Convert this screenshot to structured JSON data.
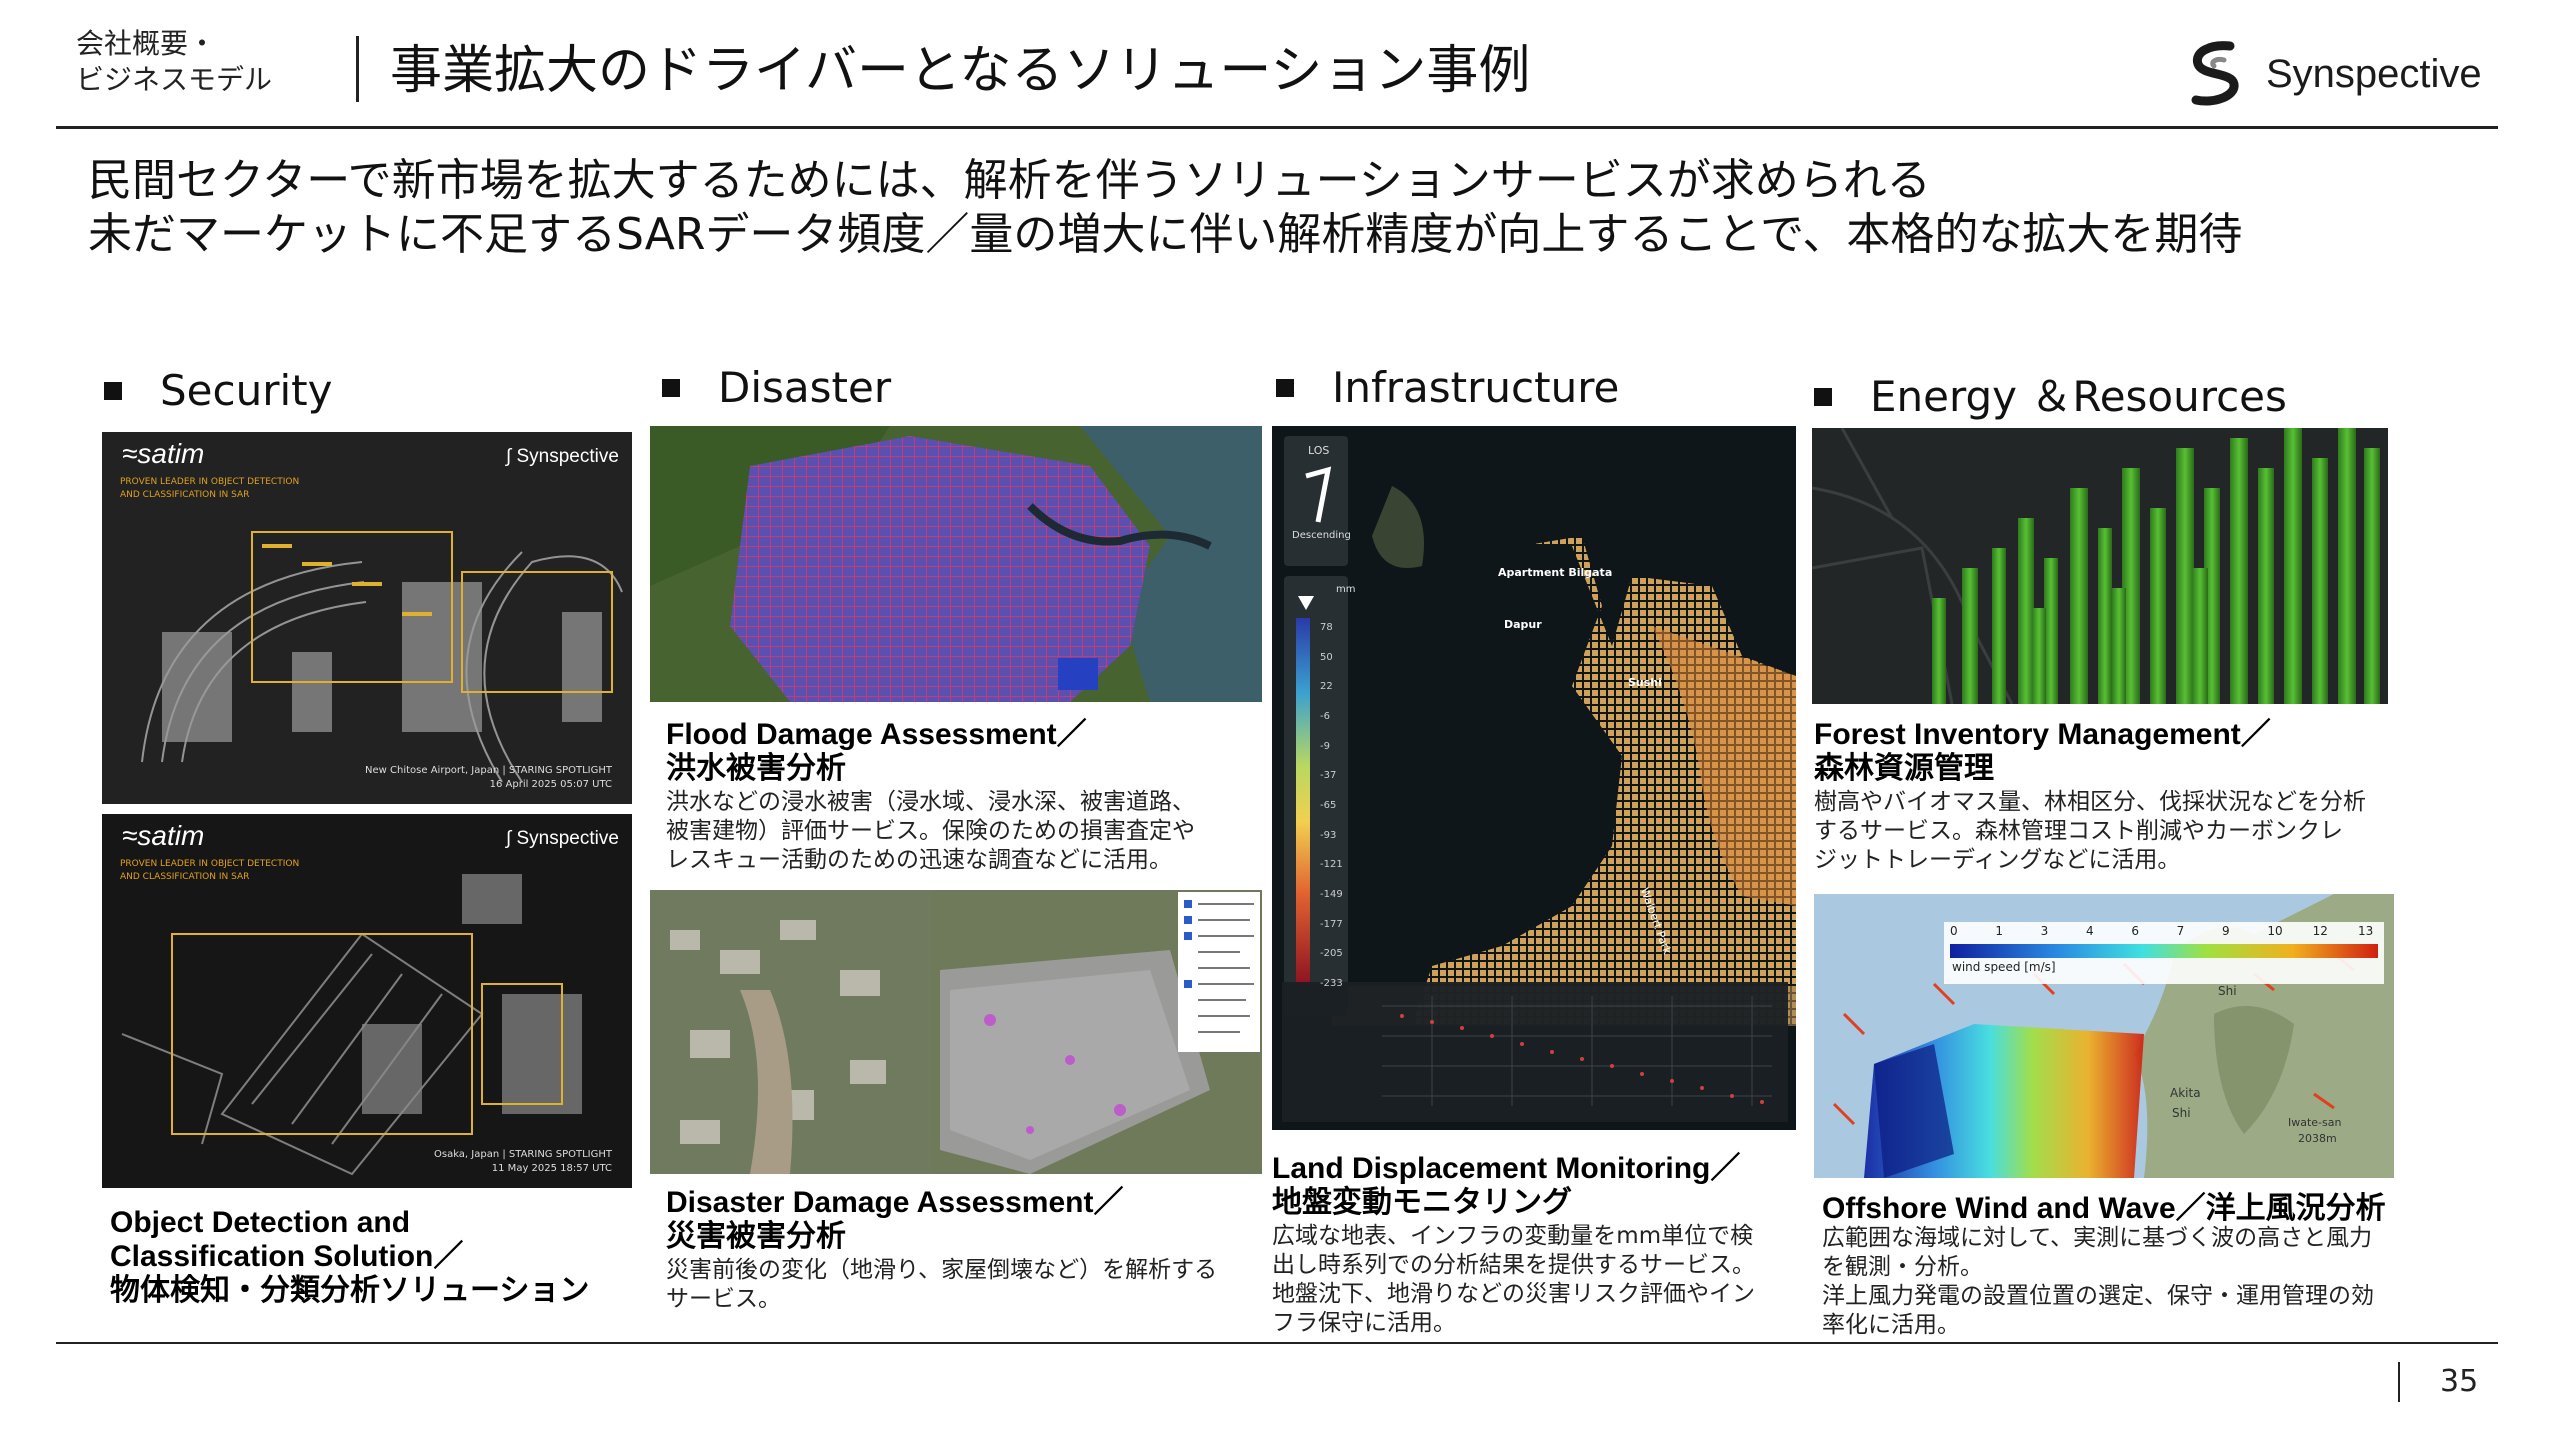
{
  "header": {
    "breadcrumb_line1": "会社概要・",
    "breadcrumb_line2": "ビジネスモデル",
    "title": "事業拡大のドライバーとなるソリューション事例",
    "brand": "Synspective"
  },
  "lead": {
    "line1": "民間セクターで新市場を拡大するためには、解析を伴うソリューションサービスが求められる",
    "line2": "未だマーケットに不足するSARデータ頻度／量の増大に伴い解析精度が向上することで、本格的な拡大を期待"
  },
  "categories": {
    "security": "Security",
    "disaster": "Disaster",
    "infrastructure": "Infrastructure",
    "energy": "Energy ＆Resources"
  },
  "security": {
    "img1": {
      "brand_left": "satim",
      "brand_right": "Synspective",
      "tag1": "PROVEN LEADER IN OBJECT DETECTION",
      "tag2": "AND CLASSIFICATION IN SAR",
      "caption1": "New Chitose Airport, Japan | STARING SPOTLIGHT",
      "caption2": "16 April 2025 05:07 UTC"
    },
    "img2": {
      "brand_left": "satim",
      "brand_right": "Synspective",
      "tag1": "PROVEN LEADER IN OBJECT DETECTION",
      "tag2": "AND CLASSIFICATION IN SAR",
      "caption1": "Osaka, Japan | STARING SPOTLIGHT",
      "caption2": "11 May 2025 18:57 UTC"
    },
    "title1": "Object Detection and",
    "title2": "Classification Solution／",
    "title3": "物体検知・分類分析ソリューション"
  },
  "disaster": {
    "flood_title1": "Flood Damage Assessment／",
    "flood_title2": "洪水被害分析",
    "flood_desc1": "洪水などの浸水被害（浸水域、浸水深、被害道路、",
    "flood_desc2": "被害建物）評価サービス。保険のための損害査定や",
    "flood_desc3": "レスキュー活動のための迅速な調査などに活用。",
    "damage_title1": "Disaster Damage Assessment／",
    "damage_title2": "災害被害分析",
    "damage_desc1": "災害前後の変化（地滑り、家屋倒壊など）を解析する",
    "damage_desc2": "サービス。"
  },
  "infrastructure": {
    "title1": "Land Displacement Monitoring／",
    "title2": "地盤変動モニタリング",
    "desc1": "広域な地表、インフラの変動量をmm単位で検",
    "desc2": "出し時系列での分析結果を提供するサービス。",
    "desc3": "地盤沈下、地滑りなどの災害リスク評価やイン",
    "desc4": "フラ保守に活用。",
    "map_los": "LOS",
    "map_desc": "Descending",
    "map_unit": "mm",
    "map_place1": "Apartment Bilgata",
    "map_place2": "Dapur",
    "map_place3": "Sushi",
    "map_place4": "Walbert Park",
    "scale_ticks": [
      "78",
      "50",
      "22",
      "-6",
      "-9",
      "-37",
      "-65",
      "-93",
      "-121",
      "-149",
      "-177",
      "-205",
      "-233"
    ]
  },
  "energy": {
    "forest_title1": "Forest Inventory Management／",
    "forest_title2": "森林資源管理",
    "forest_desc1": "樹高やバイオマス量、林相区分、伐採状況などを分析",
    "forest_desc2": "するサービス。森林管理コスト削減やカーボンクレ",
    "forest_desc3": "ジットトレーディングなどに活用。",
    "wind_title": "Offshore Wind and Wave／洋上風況分析",
    "wind_desc1": "広範囲な海域に対して、実測に基づく波の高さと風力",
    "wind_desc2": "を観測・分析。",
    "wind_desc3": "洋上風力発電の設置位置の選定、保守・運用管理の効",
    "wind_desc4": "率化に活用。",
    "wind_scale_ticks": [
      "0",
      "1",
      "3",
      "4",
      "6",
      "7",
      "9",
      "10",
      "12",
      "13"
    ],
    "wind_scale_label": "wind speed [m/s]",
    "map_place1": "Shi",
    "map_place2": "Akita",
    "map_place3": "Shi",
    "map_place4": "Iwate-san",
    "map_place5": "2038m"
  },
  "page_number": "35",
  "colors": {
    "text": "#111111",
    "rule": "#222222",
    "flood_overlay": "#c0309a",
    "forest_green": "#3fa02a",
    "disp_orange": "#e8a85a"
  }
}
